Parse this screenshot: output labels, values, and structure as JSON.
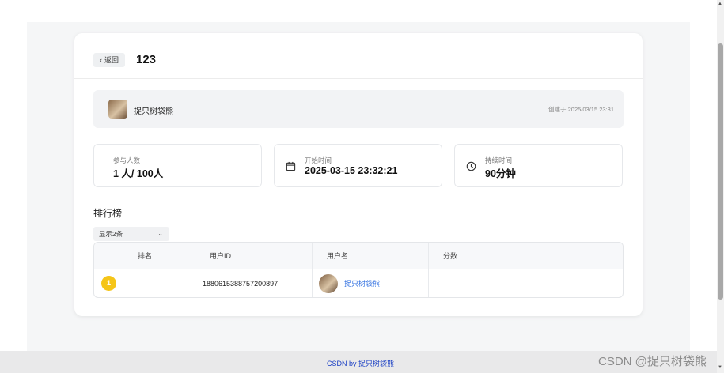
{
  "header": {
    "back_label": "返回",
    "title": "123"
  },
  "creator": {
    "name": "捉只树袋熊",
    "created_at": "创建于 2025/03/15 23:31"
  },
  "stats": {
    "participants": {
      "label": "参与人数",
      "value": "1 人/ 100人"
    },
    "start_time": {
      "label": "开始时间",
      "value": "2025-03-15 23:32:21",
      "icon": "calendar-icon"
    },
    "duration": {
      "label": "持续时间",
      "value": "90分钟",
      "icon": "clock-icon"
    }
  },
  "leaderboard": {
    "title": "排行榜",
    "select_value": "显示2条",
    "columns": [
      "排名",
      "用户ID",
      "用户名",
      "分数"
    ],
    "rows": [
      {
        "rank": "1",
        "user_id": "1880615388757200897",
        "username": "捉只树袋熊",
        "score": ""
      }
    ]
  },
  "footer": {
    "link_text": "CSDN by 捉只树袋熊",
    "watermark": "CSDN @捉只树袋熊"
  },
  "colors": {
    "rank_gold": "#f5c518",
    "link_blue": "#2f6fe0",
    "page_bg": "#f5f6f7"
  }
}
